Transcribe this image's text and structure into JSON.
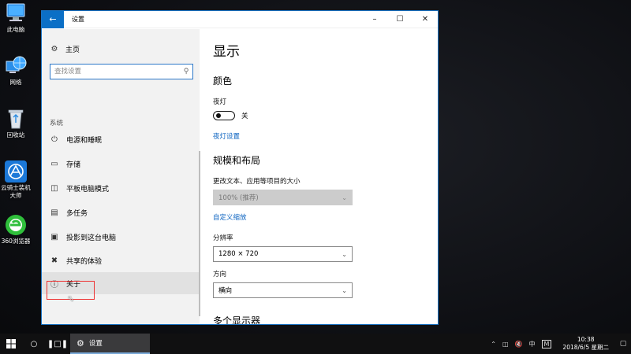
{
  "desktop": {
    "icons": [
      {
        "label": "此电脑"
      },
      {
        "label": "网络"
      },
      {
        "label": "回收站"
      },
      {
        "label": "云骑士装机大师"
      },
      {
        "label": "360浏览器"
      }
    ]
  },
  "window": {
    "title": "设置",
    "back_icon": "arrow-left-icon",
    "controls": [
      "minimize",
      "maximize",
      "close"
    ]
  },
  "sidebar": {
    "home_label": "主页",
    "search_placeholder": "查找设置",
    "section_label": "系统",
    "items": [
      {
        "label": "电源和睡眠",
        "icon": "power-icon"
      },
      {
        "label": "存储",
        "icon": "storage-icon"
      },
      {
        "label": "平板电脑模式",
        "icon": "tablet-mode-icon"
      },
      {
        "label": "多任务",
        "icon": "multitasking-icon"
      },
      {
        "label": "投影到这台电脑",
        "icon": "project-icon"
      },
      {
        "label": "共享的体验",
        "icon": "shared-experience-icon"
      },
      {
        "label": "关于",
        "icon": "info-icon",
        "selected": true
      }
    ]
  },
  "content": {
    "page_title": "显示",
    "color_heading": "颜色",
    "night_light_label": "夜灯",
    "night_light_state": "关",
    "night_light_on": false,
    "night_light_settings_link": "夜灯设置",
    "scale_heading": "规模和布局",
    "scale_label": "更改文本、应用等项目的大小",
    "scale_value": "100% (推荐)",
    "custom_scale_link": "自定义缩放",
    "resolution_label": "分辨率",
    "resolution_value": "1280 × 720",
    "orientation_label": "方向",
    "orientation_value": "横向",
    "multi_display_heading": "多个显示器"
  },
  "taskbar": {
    "app_label": "设置",
    "tray": {
      "ime_label": "中",
      "m_label": "M",
      "time": "10:38",
      "date": "2018/6/5 星期二"
    }
  },
  "colors": {
    "accent": "#0b6fc6",
    "link": "#0b63c0",
    "highlight_box": "#ee3333"
  }
}
